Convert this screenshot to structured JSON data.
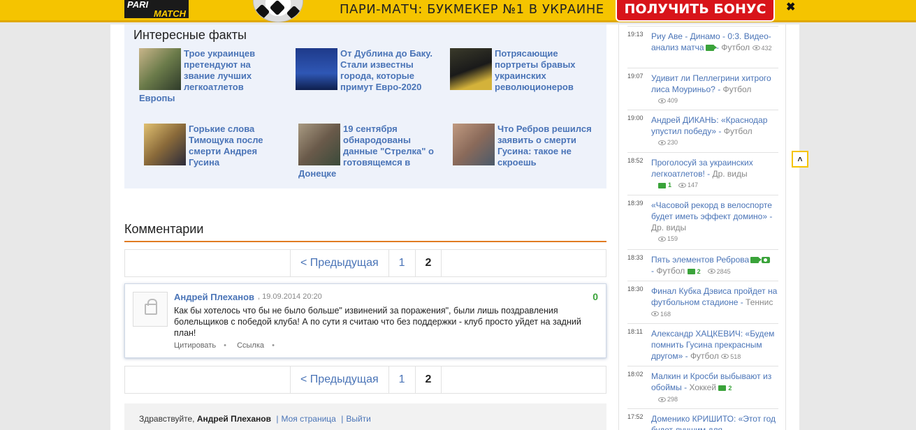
{
  "banner": {
    "logo_line1": "PARI",
    "logo_line2": "MATCH",
    "slogan": "ПАРИ-МАТЧ: БУКМЕКЕР №1 В УКРАИНЕ",
    "bonus_label": "ПОЛУЧИТЬ БОНУС",
    "close_label": "✖"
  },
  "facts": {
    "title": "Интересные факты",
    "items": [
      {
        "text": "Трое украинцев претендуют на звание лучших легкоатлетов Европы"
      },
      {
        "text": "От Дублина до Баку. Стали известны города, которые примут Евро-2020"
      },
      {
        "text": "Потрясающие портреты бравых украинских революционеров"
      },
      {
        "text": "Горькие слова Тимощука после смерти Андрея Гусина"
      },
      {
        "text": "19 сентября обнародованы данные \"Стрелка\" о готовящемся в Донецке"
      },
      {
        "text": "Что Ребров решился заявить о смерти Гусина: такое не скроешь"
      }
    ]
  },
  "comments": {
    "title": "Комментарии",
    "pager": {
      "prev_label": "< Предыдущая",
      "pages": [
        "1",
        "2"
      ],
      "current": "2"
    },
    "items": [
      {
        "author": "Андрей Плеханов",
        "date": ", 19.09.2014 20:20",
        "score": "0",
        "body": "Как бы хотелось что бы не было больше\" извинений за поражения\", были лишь поздравления болельщиков с победой клуба! А по сути я считаю что без поддержки - клуб просто уйдет на задний план!",
        "quote_label": "Цитировать",
        "link_label": "Ссылка",
        "dot": "•"
      }
    ]
  },
  "greeting": {
    "hello": "Здравствуйте, ",
    "name": "Андрей Плеханов",
    "my_page": "Моя страница",
    "logout": "Выйти",
    "separator": "|"
  },
  "news": [
    {
      "time": "19:13",
      "title": "Риу Аве - Динамо - 0:3. Видео-анализ матча",
      "video": true,
      "photo": false,
      "category": "Футбол",
      "comments": "",
      "views": "432"
    },
    {
      "time": "19:07",
      "title": "Удивит ли Пеллегрини хитрого лиса Моуриньо?",
      "video": false,
      "photo": false,
      "category": "Футбол",
      "comments": "",
      "views": "409"
    },
    {
      "time": "19:00",
      "title": "Андрей ДИКАНЬ: «Краснодар упустил победу»",
      "video": false,
      "photo": false,
      "category": "Футбол",
      "comments": "",
      "views": "230"
    },
    {
      "time": "18:52",
      "title": "Проголосуй за украинских легкоатлетов!",
      "video": false,
      "photo": false,
      "category": "Др. виды",
      "comments": "1",
      "views": "147"
    },
    {
      "time": "18:39",
      "title": "«Часовой рекорд в велоспорте будет иметь эффект домино»",
      "video": false,
      "photo": false,
      "category": "Др. виды",
      "comments": "",
      "views": "159"
    },
    {
      "time": "18:33",
      "title": "Пять элементов Реброва",
      "video": true,
      "photo": true,
      "category": "Футбол",
      "comments": "2",
      "views": "2845"
    },
    {
      "time": "18:30",
      "title": "Финал Кубка Дэвиса пройдет на футбольном стадионе",
      "video": false,
      "photo": false,
      "category": "Теннис",
      "comments": "",
      "views": "168"
    },
    {
      "time": "18:11",
      "title": "Александр ХАЦКЕВИЧ: «Будем помнить Гусина прекрасным другом»",
      "video": false,
      "photo": false,
      "category": "Футбол",
      "comments": "",
      "views": "518"
    },
    {
      "time": "18:02",
      "title": "Малкин и Кросби выбывают из обоймы",
      "video": false,
      "photo": false,
      "category": "Хоккей",
      "comments": "2",
      "views": "298"
    },
    {
      "time": "17:52",
      "title": "Доменико КРИШИТО: «Этот год будет лучшим для",
      "video": false,
      "photo": false,
      "category": "",
      "comments": "",
      "views": ""
    }
  ],
  "scroll_top_label": "˄",
  "colors": {
    "link": "#4a74b7",
    "accent_orange": "#e07b22",
    "banner_yellow": "#f5c400",
    "bonus_red": "#d8141a",
    "green": "#3aa33a"
  }
}
